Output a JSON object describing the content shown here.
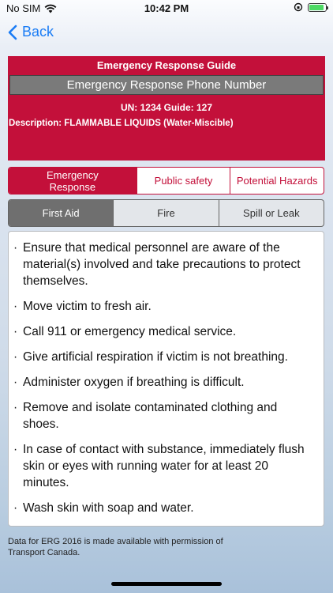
{
  "status": {
    "carrier": "No SIM",
    "time": "10:42 PM",
    "battery_percent": 90
  },
  "nav": {
    "back_label": "Back"
  },
  "guide": {
    "title": "Emergency Response Guide",
    "phone_button": "Emergency Response Phone Number",
    "un_line": "UN: 1234   Guide: 127",
    "description": "Description: FLAMMABLE LIQUIDS  (Water-Miscible)"
  },
  "tabs_primary": [
    {
      "label": "Emergency Response",
      "active": true
    },
    {
      "label": "Public safety",
      "active": false
    },
    {
      "label": "Potential Hazards",
      "active": false
    }
  ],
  "tabs_secondary": [
    {
      "label": "First Aid",
      "active": true
    },
    {
      "label": "Fire",
      "active": false
    },
    {
      "label": "Spill or Leak",
      "active": false
    }
  ],
  "content": {
    "bullet_char": "·",
    "items": [
      "Ensure that medical personnel are aware of the material(s) involved and take precautions to protect themselves.",
      "Move victim to fresh air.",
      "Call 911 or emergency medical service.",
      "Give artificial respiration if victim is not breathing.",
      "Administer oxygen if breathing is difficult.",
      "Remove and isolate contaminated clothing and shoes.",
      "In case of contact with substance, immediately flush skin or eyes with running water for at least 20 minutes.",
      "Wash skin with soap and water."
    ]
  },
  "footer": "Data for ERG 2016 is made available with permission of Transport Canada.",
  "colors": {
    "accent_red": "#c3103a",
    "link_blue": "#1a7cf5",
    "segment_gray": "#6f6f6f"
  }
}
